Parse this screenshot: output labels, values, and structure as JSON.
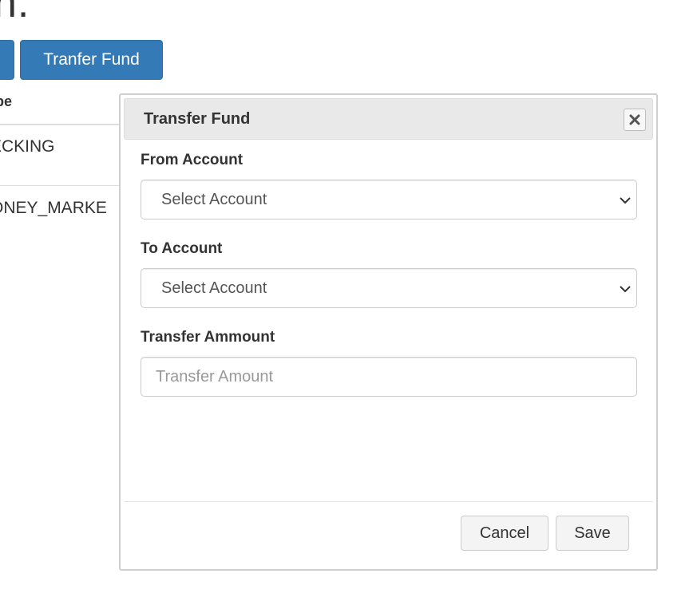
{
  "background": {
    "heading": "n.",
    "buttons": {
      "transfer_label": "Tranfer Fund"
    },
    "table": {
      "column_header": "pe",
      "rows": [
        "ECKING",
        "ONEY_MARKE"
      ]
    }
  },
  "modal": {
    "title": "Transfer Fund",
    "from_account": {
      "label": "From Account",
      "selected": "Select Account"
    },
    "to_account": {
      "label": "To Account",
      "selected": "Select Account"
    },
    "amount": {
      "label": "Transfer Ammount",
      "value": "",
      "placeholder": "Transfer Amount"
    },
    "footer": {
      "cancel_label": "Cancel",
      "save_label": "Save"
    }
  },
  "icons": {
    "close": "close-icon",
    "select_arrow": "chevron-down-icon"
  },
  "colors": {
    "primary": "#337ab7",
    "modal_header_bg": "#e9e9e9",
    "border": "#cccccc"
  }
}
